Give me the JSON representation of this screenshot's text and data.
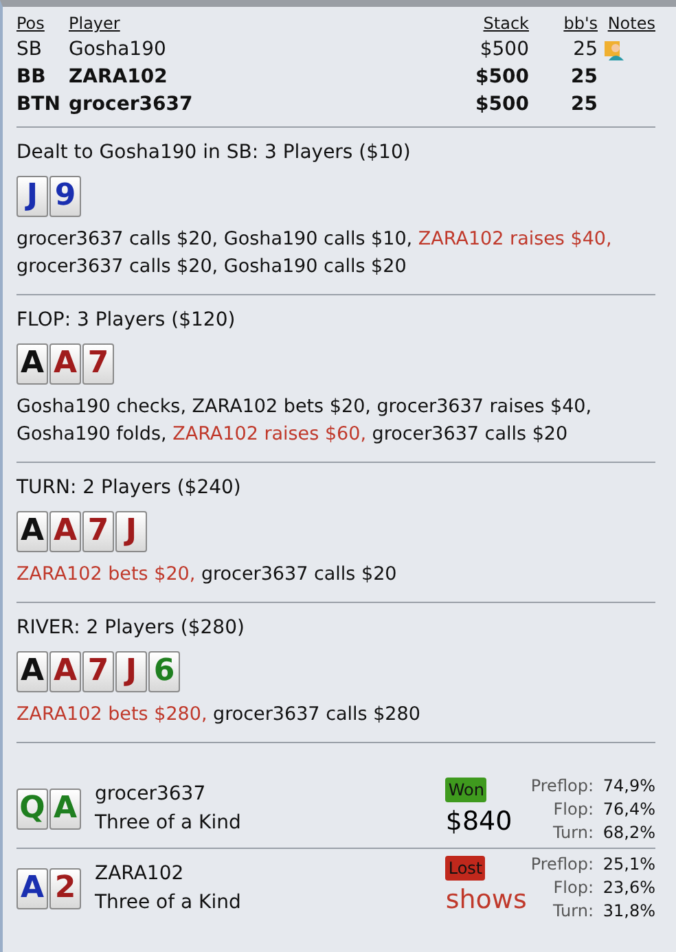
{
  "players": {
    "columns": [
      "Pos",
      "Player",
      "Stack",
      "bb's",
      "Notes"
    ],
    "rows": [
      {
        "pos": "SB",
        "name": "Gosha190",
        "stack": "$500",
        "bbs": "25",
        "bold": false,
        "has_note": true
      },
      {
        "pos": "BB",
        "name": "ZARA102",
        "stack": "$500",
        "bbs": "25",
        "bold": true,
        "has_note": false
      },
      {
        "pos": "BTN",
        "name": "grocer3637",
        "stack": "$500",
        "bbs": "25",
        "bold": true,
        "has_note": false
      }
    ]
  },
  "streets": [
    {
      "title": "Dealt to Gosha190 in SB: 3 Players ($10)",
      "cards": [
        {
          "rank": "J",
          "color": "#1a2fb0"
        },
        {
          "rank": "9",
          "color": "#1a2fb0"
        }
      ],
      "actions": [
        {
          "text": "grocer3637 calls $20, Gosha190 calls $10, ",
          "highlight": false
        },
        {
          "text": "ZARA102 raises $40,",
          "highlight": true
        },
        {
          "text": " grocer3637 calls $20, Gosha190 calls $20",
          "highlight": false
        }
      ]
    },
    {
      "title": "FLOP: 3 Players ($120)",
      "cards": [
        {
          "rank": "A",
          "color": "#111111"
        },
        {
          "rank": "A",
          "color": "#a01c1c"
        },
        {
          "rank": "7",
          "color": "#a01c1c"
        }
      ],
      "actions": [
        {
          "text": "Gosha190 checks, ZARA102 bets $20, grocer3637 raises $40, Gosha190 folds, ",
          "highlight": false
        },
        {
          "text": "ZARA102 raises $60,",
          "highlight": true
        },
        {
          "text": " grocer3637 calls $20",
          "highlight": false
        }
      ]
    },
    {
      "title": "TURN: 2 Players ($240)",
      "cards": [
        {
          "rank": "A",
          "color": "#111111"
        },
        {
          "rank": "A",
          "color": "#a01c1c"
        },
        {
          "rank": "7",
          "color": "#a01c1c"
        },
        {
          "rank": "J",
          "color": "#a01c1c"
        }
      ],
      "actions": [
        {
          "text": "ZARA102 bets $20,",
          "highlight": true
        },
        {
          "text": " grocer3637 calls $20",
          "highlight": false
        }
      ]
    },
    {
      "title": "RIVER: 2 Players ($280)",
      "cards": [
        {
          "rank": "A",
          "color": "#111111"
        },
        {
          "rank": "A",
          "color": "#a01c1c"
        },
        {
          "rank": "7",
          "color": "#a01c1c"
        },
        {
          "rank": "J",
          "color": "#a01c1c"
        },
        {
          "rank": "6",
          "color": "#1f7f1f"
        }
      ],
      "actions": [
        {
          "text": "ZARA102 bets $280,",
          "highlight": true
        },
        {
          "text": " grocer3637 calls $280",
          "highlight": false
        }
      ]
    }
  ],
  "results": [
    {
      "cards": [
        {
          "rank": "Q",
          "color": "#1f7f1f"
        },
        {
          "rank": "A",
          "color": "#1f7f1f"
        }
      ],
      "name": "grocer3637",
      "hand": "Three of a Kind",
      "kind": "won",
      "badge": "Won",
      "amount": "$840",
      "equity": [
        {
          "label": "Preflop:",
          "value": "74,9%"
        },
        {
          "label": "Flop:",
          "value": "76,4%"
        },
        {
          "label": "Turn:",
          "value": "68,2%"
        }
      ]
    },
    {
      "cards": [
        {
          "rank": "A",
          "color": "#1a2fb0"
        },
        {
          "rank": "2",
          "color": "#a01c1c"
        }
      ],
      "name": "ZARA102",
      "hand": "Three of a Kind",
      "kind": "lost",
      "badge": "Lost",
      "amount": "shows",
      "equity": [
        {
          "label": "Preflop:",
          "value": "25,1%"
        },
        {
          "label": "Flop:",
          "value": "23,6%"
        },
        {
          "label": "Turn:",
          "value": "31,8%"
        }
      ]
    }
  ]
}
